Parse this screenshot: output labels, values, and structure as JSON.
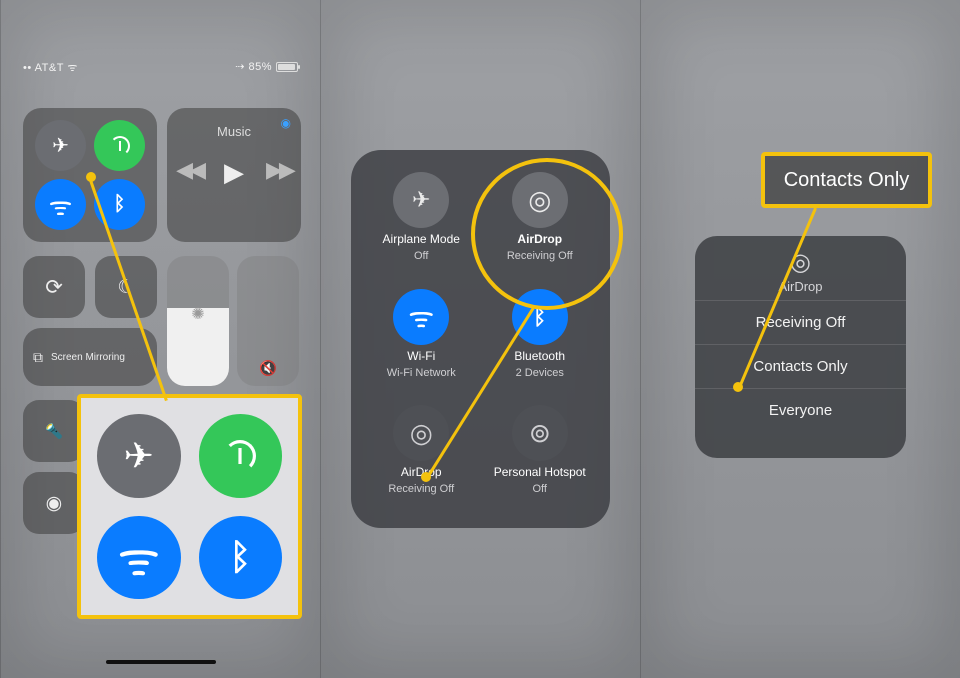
{
  "panel1": {
    "status": {
      "carrier": "AT&T",
      "battery_percent": "85%"
    },
    "music_label": "Music",
    "screen_mirror_label": "Screen Mirroring"
  },
  "panel2": {
    "airplane": {
      "label": "Airplane Mode",
      "sub": "Off"
    },
    "airdrop_big": {
      "label": "AirDrop",
      "sub": "Receiving Off"
    },
    "wifi": {
      "label": "Wi-Fi",
      "sub": "Wi-Fi Network"
    },
    "bluetooth": {
      "label": "Bluetooth",
      "sub": "2 Devices"
    },
    "airdrop": {
      "label": "AirDrop",
      "sub": "Receiving Off"
    },
    "hotspot": {
      "label": "Personal Hotspot",
      "sub": "Off"
    }
  },
  "panel3": {
    "badge": "Contacts Only",
    "airdrop_title": "AirDrop",
    "options": [
      "Receiving Off",
      "Contacts Only",
      "Everyone"
    ]
  }
}
